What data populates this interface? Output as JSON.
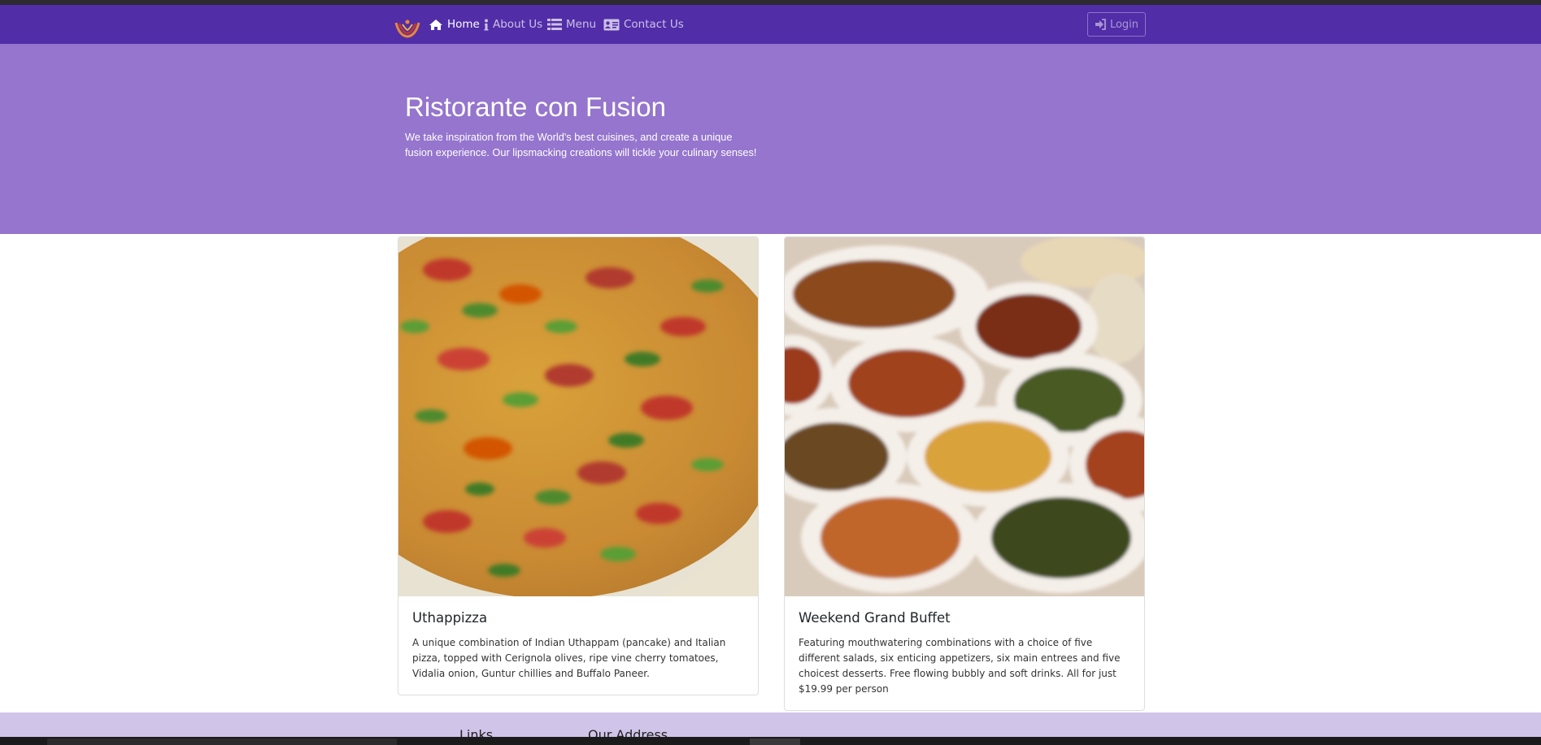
{
  "navbar": {
    "brand_icon": "restaurant-logo",
    "items": [
      {
        "label": "Home",
        "icon": "home-icon",
        "active": true
      },
      {
        "label": "About Us",
        "icon": "info-icon",
        "active": false
      },
      {
        "label": "Menu",
        "icon": "list-icon",
        "active": false
      },
      {
        "label": "Contact Us",
        "icon": "address-card-icon",
        "active": false
      }
    ],
    "login": {
      "label": "Login",
      "icon": "sign-in-icon"
    }
  },
  "jumbotron": {
    "title": "Ristorante con Fusion",
    "text": "We take inspiration from the World's best cuisines, and create a unique fusion experience. Our lipsmacking creations will tickle your culinary senses!"
  },
  "cards": [
    {
      "title": "Uthappizza",
      "text": "A unique combination of Indian Uthappam (pancake) and Italian pizza, topped with Cerignola olives, ripe vine cherry tomatoes, Vidalia onion, Guntur chillies and Buffalo Paneer.",
      "image": "pizza-image"
    },
    {
      "title": "Weekend Grand Buffet",
      "text": "Featuring mouthwatering combinations with a choice of five different salads, six enticing appetizers, six main entrees and five choicest desserts. Free flowing bubbly and soft drinks. All for just $19.99 per person",
      "image": "buffet-image"
    }
  ],
  "footer": {
    "links_heading": "Links",
    "address_heading": "Our Address"
  },
  "colors": {
    "navbar": "#512da8",
    "jumbotron": "#9575cd",
    "footer": "#d1c4e9"
  }
}
